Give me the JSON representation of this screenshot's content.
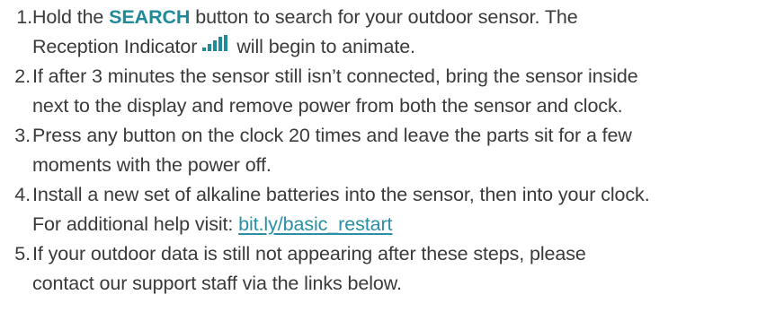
{
  "steps": [
    {
      "number": "1.",
      "parts": {
        "before": "Hold the ",
        "bold": "SEARCH",
        "after": " button to search for your outdoor sensor. The",
        "line2_before": "Reception Indicator",
        "line2_after": "will begin to animate."
      }
    },
    {
      "number": "2.",
      "line1": "If after 3 minutes the sensor still isn’t connected, bring the sensor inside",
      "line2": "next to the display and remove power from both the sensor and clock."
    },
    {
      "number": "3.",
      "line1": "Press any button on the clock 20 times and leave the parts sit for a few",
      "line2": "moments with the power off."
    },
    {
      "number": "4.",
      "line1": "Install a new set of alkaline batteries into the sensor, then into your clock.",
      "line2_before": "For additional help visit: ",
      "link": "bit.ly/basic_restart"
    },
    {
      "number": "5.",
      "line1": "If your outdoor data is still not appearing after these steps, please",
      "line2": "contact our support staff via the links below."
    }
  ],
  "icons": {
    "reception_indicator": "signal-bars-icon"
  },
  "colors": {
    "text": "#3a3a3a",
    "accent": "#1f8a9a",
    "link": "#2a8fa5"
  }
}
